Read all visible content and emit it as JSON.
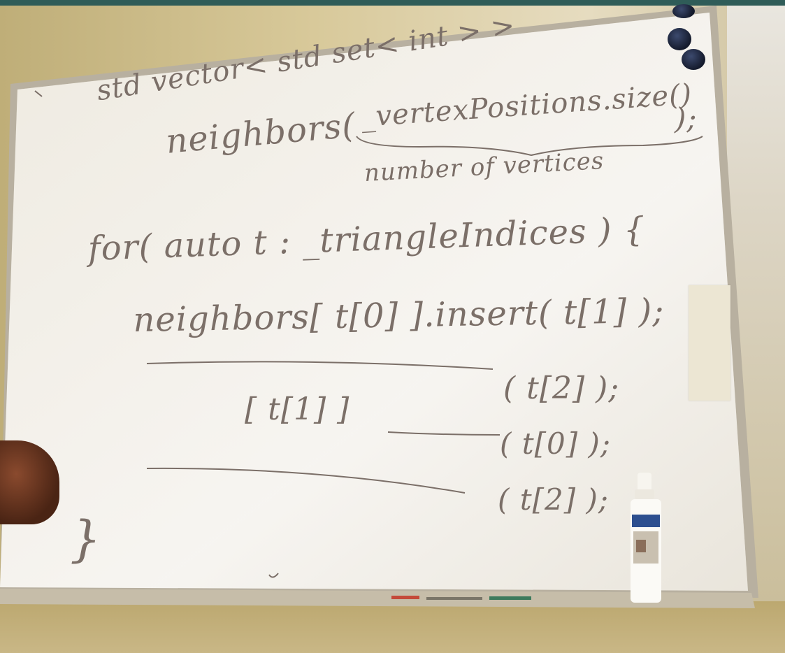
{
  "whiteboard": {
    "lines": {
      "l1": "std vector< std set< int > >",
      "l2": "neighbors(",
      "l3": "_vertexPositions.size()",
      "l4": ");",
      "l5": "number of vertices",
      "l6": "for( auto t : _triangleIndices ) {",
      "l7": "neighbors[ t[0] ].insert( t[1] );",
      "l8": "( t[2] );",
      "l9": "[ t[1] ]",
      "l10": "( t[0] );",
      "l11": "( t[2] );",
      "l12": "}"
    },
    "colors": {
      "ink": "#7b6f68",
      "board": "#f1eee8",
      "frame": "#b9b1a0",
      "magnet": "#1d2440"
    }
  }
}
